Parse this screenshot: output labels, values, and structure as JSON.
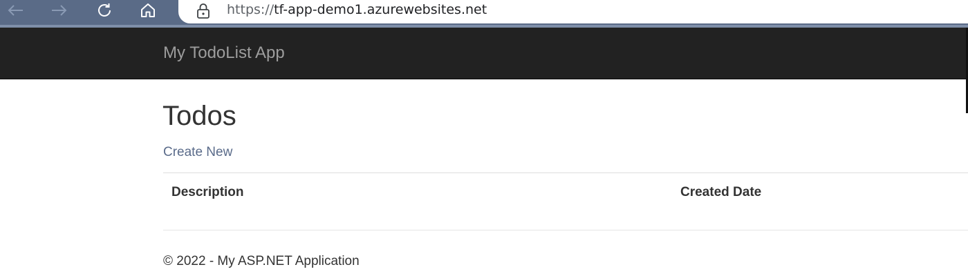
{
  "browser": {
    "url_scheme": "https://",
    "url_rest": "tf-app-demo1.azurewebsites.net",
    "icons": [
      "back-arrow-icon",
      "forward-arrow-icon",
      "refresh-icon",
      "home-icon",
      "lock-icon"
    ]
  },
  "navbar": {
    "brand": "My TodoList App"
  },
  "main": {
    "title": "Todos",
    "create_link": "Create New",
    "table": {
      "headers": [
        "Description",
        "Created Date"
      ],
      "rows": []
    }
  },
  "footer": {
    "text": "© 2022 - My ASP.NET Application"
  },
  "colors": {
    "navbar_bg": "#222222",
    "brand_text": "#9d9d9d",
    "link": "#5a6b8a",
    "browser_chrome": "#5a6b87"
  }
}
